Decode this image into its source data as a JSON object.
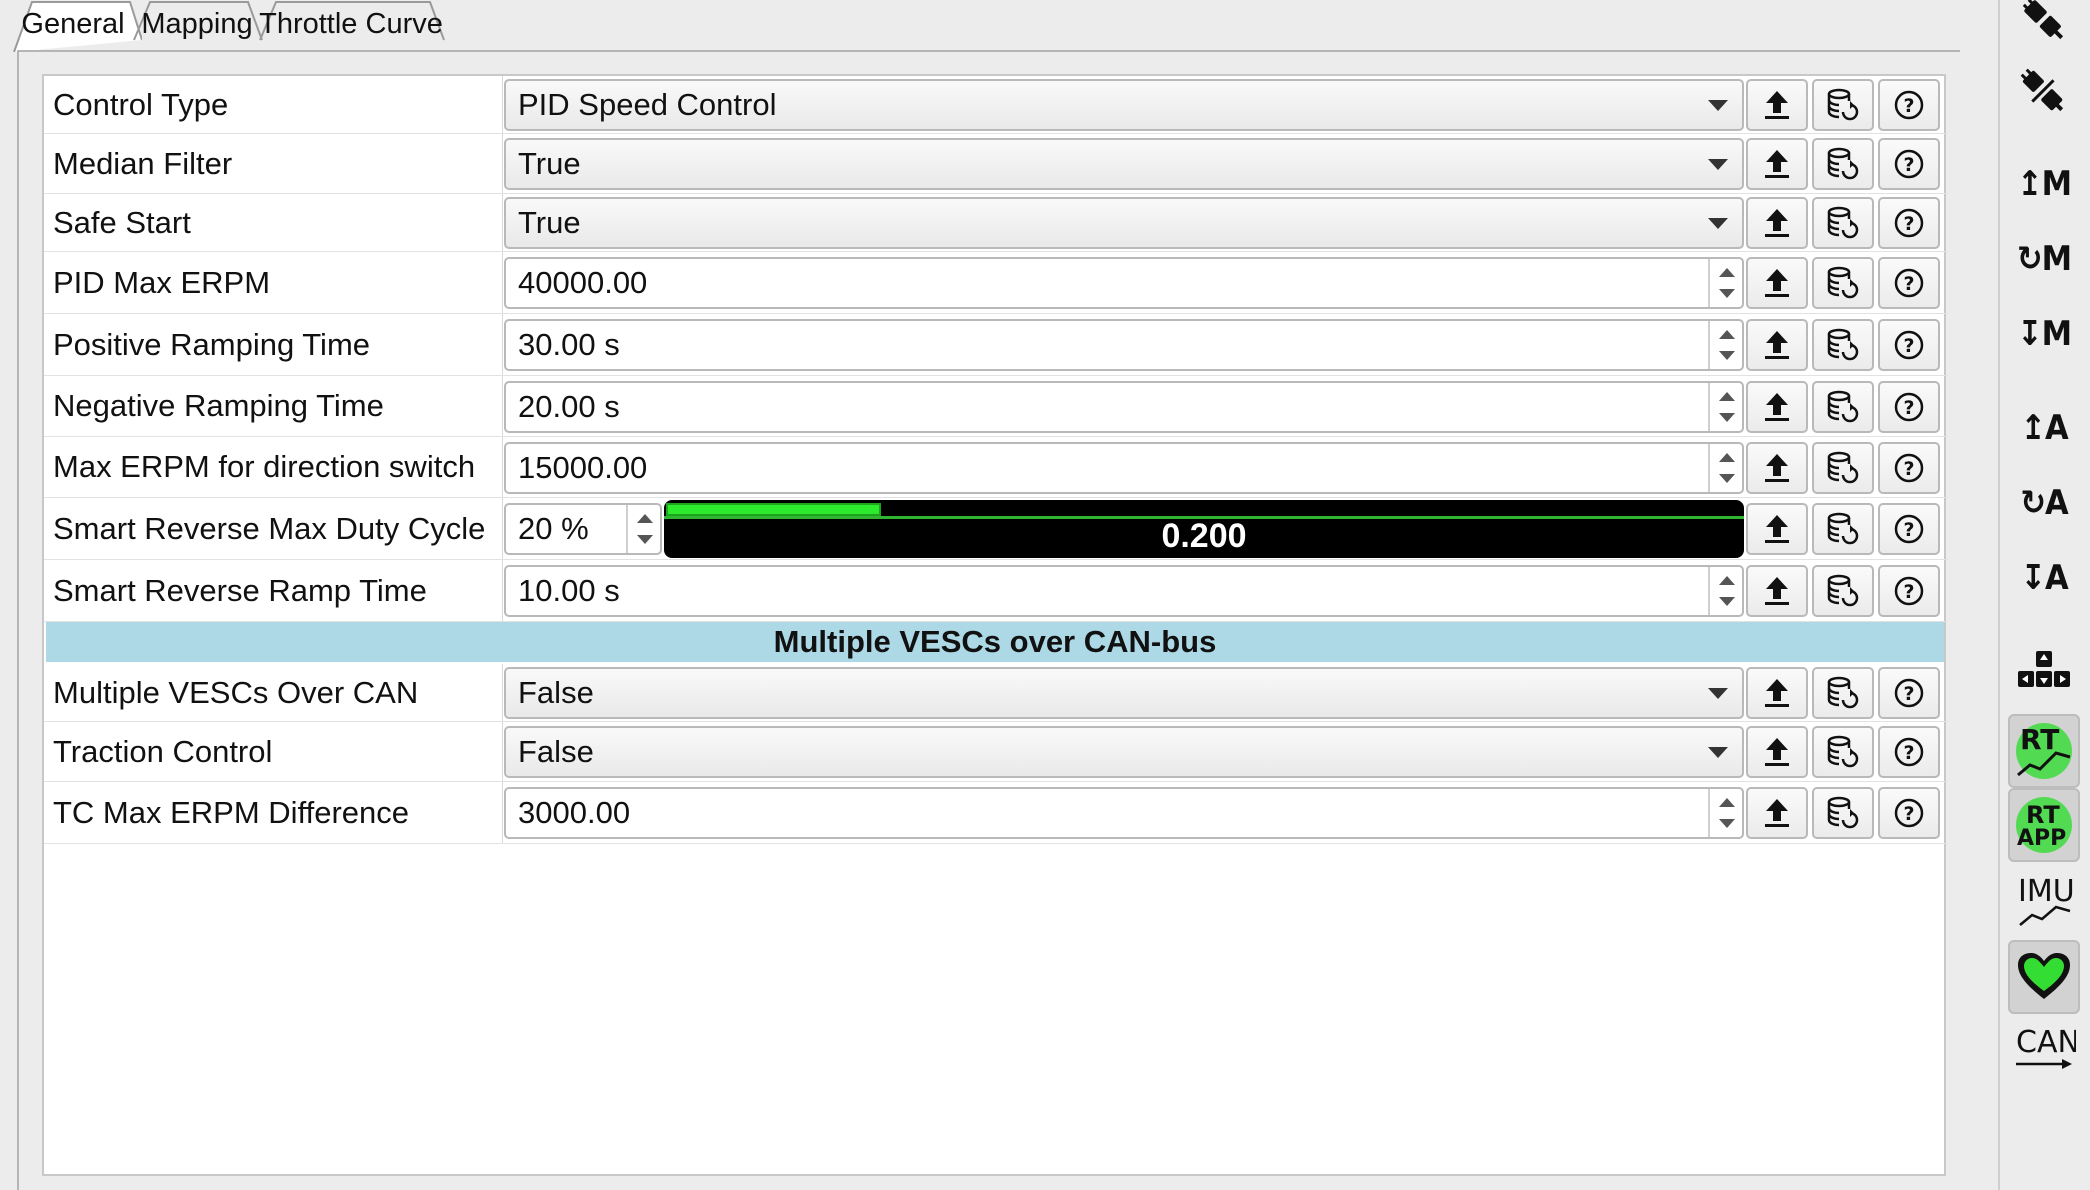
{
  "tabs": [
    {
      "label": "General",
      "active": true
    },
    {
      "label": "Mapping",
      "active": false
    },
    {
      "label": "Throttle Curve",
      "active": false
    }
  ],
  "rows": [
    {
      "label": "Control Type",
      "kind": "combo",
      "value": "PID Speed Control"
    },
    {
      "label": "Median Filter",
      "kind": "combo",
      "value": "True"
    },
    {
      "label": "Safe Start",
      "kind": "combo",
      "value": "True"
    },
    {
      "label": "PID Max ERPM",
      "kind": "spin",
      "value": "40000.00"
    },
    {
      "label": "Positive Ramping Time",
      "kind": "spin",
      "value": "30.00 s"
    },
    {
      "label": "Negative Ramping Time",
      "kind": "spin",
      "value": "20.00 s"
    },
    {
      "label": "Max ERPM for direction switch",
      "kind": "spin",
      "value": "15000.00"
    },
    {
      "label": "Smart Reverse Max Duty Cycle",
      "kind": "duty",
      "value": "20 %",
      "bar_value": "0.200",
      "bar_fraction": 0.2
    },
    {
      "label": "Smart Reverse Ramp Time",
      "kind": "spin",
      "value": "10.00 s"
    }
  ],
  "section": {
    "title": "Multiple VESCs over CAN-bus"
  },
  "rows2": [
    {
      "label": "Multiple VESCs Over CAN",
      "kind": "combo",
      "value": "False"
    },
    {
      "label": "Traction Control",
      "kind": "combo",
      "value": "False"
    },
    {
      "label": "TC Max ERPM Difference",
      "kind": "spin",
      "value": "3000.00"
    }
  ],
  "row_actions": [
    "upload-icon",
    "database-reload-icon",
    "help-icon"
  ],
  "sidebar": {
    "items": [
      {
        "name": "connect-icon",
        "text": ""
      },
      {
        "name": "disconnect-icon",
        "text": ""
      },
      {
        "name": "write-motor-config",
        "text": "↥M"
      },
      {
        "name": "read-motor-config",
        "text": "↻M"
      },
      {
        "name": "read-default-motor-config",
        "text": "↧M"
      },
      {
        "name": "write-app-config",
        "text": "↥A"
      },
      {
        "name": "read-app-config",
        "text": "↻A"
      },
      {
        "name": "read-default-app-config",
        "text": "↧A"
      },
      {
        "name": "keyboard-control-icon",
        "text": ""
      },
      {
        "name": "rt-data",
        "text": "RT"
      },
      {
        "name": "rt-app-data",
        "text": "RT APP"
      },
      {
        "name": "imu-data",
        "text": "IMU"
      },
      {
        "name": "heartbeat-icon",
        "text": ""
      },
      {
        "name": "can-forward",
        "text": "CAN"
      }
    ]
  },
  "colors": {
    "section_bg": "#add8e6",
    "duty_fill": "#2cea2c",
    "accent_green": "#33cc33"
  }
}
